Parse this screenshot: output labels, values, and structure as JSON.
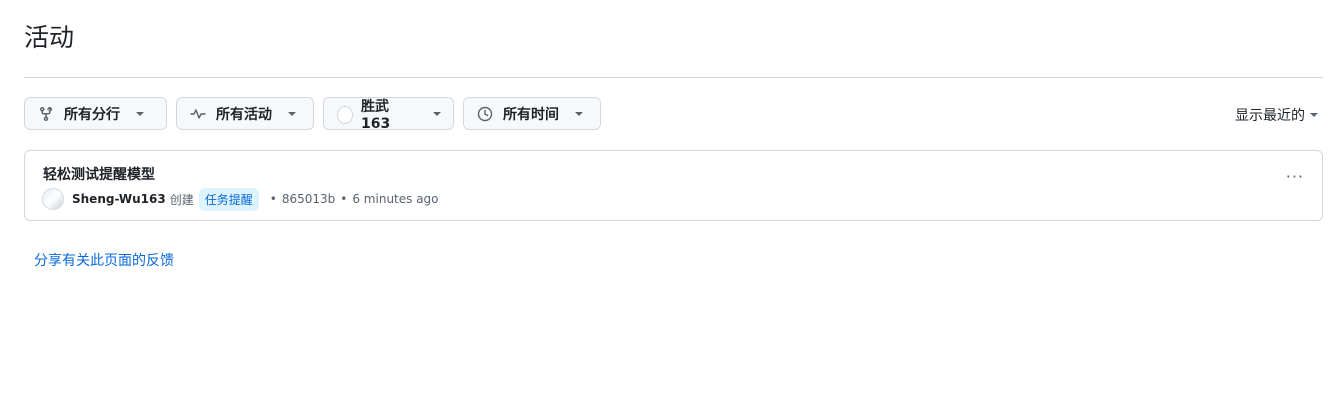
{
  "page": {
    "title": "活动"
  },
  "filters": {
    "branch": {
      "label": "所有分行",
      "icon": "git-branch-icon"
    },
    "activity": {
      "label": "所有活动",
      "icon": "pulse-icon"
    },
    "user": {
      "label": "胜武163",
      "icon": "avatar-icon"
    },
    "time": {
      "label": "所有时间",
      "icon": "clock-icon"
    }
  },
  "sort": {
    "label": "显示最近的"
  },
  "activity_items": [
    {
      "title": "轻松测试提醒模型",
      "user": "Sheng-Wu163",
      "verb": "创建",
      "branch": "任务提醒",
      "sep1": "•",
      "commit": "865013b",
      "sep2": "•",
      "time": "6 minutes ago",
      "more": "···"
    }
  ],
  "footer": {
    "feedback_link": "分享有关此页面的反馈"
  },
  "colors": {
    "accent": "#0969da",
    "badge_bg": "#ddf4ff",
    "border": "#d1d9e0"
  }
}
